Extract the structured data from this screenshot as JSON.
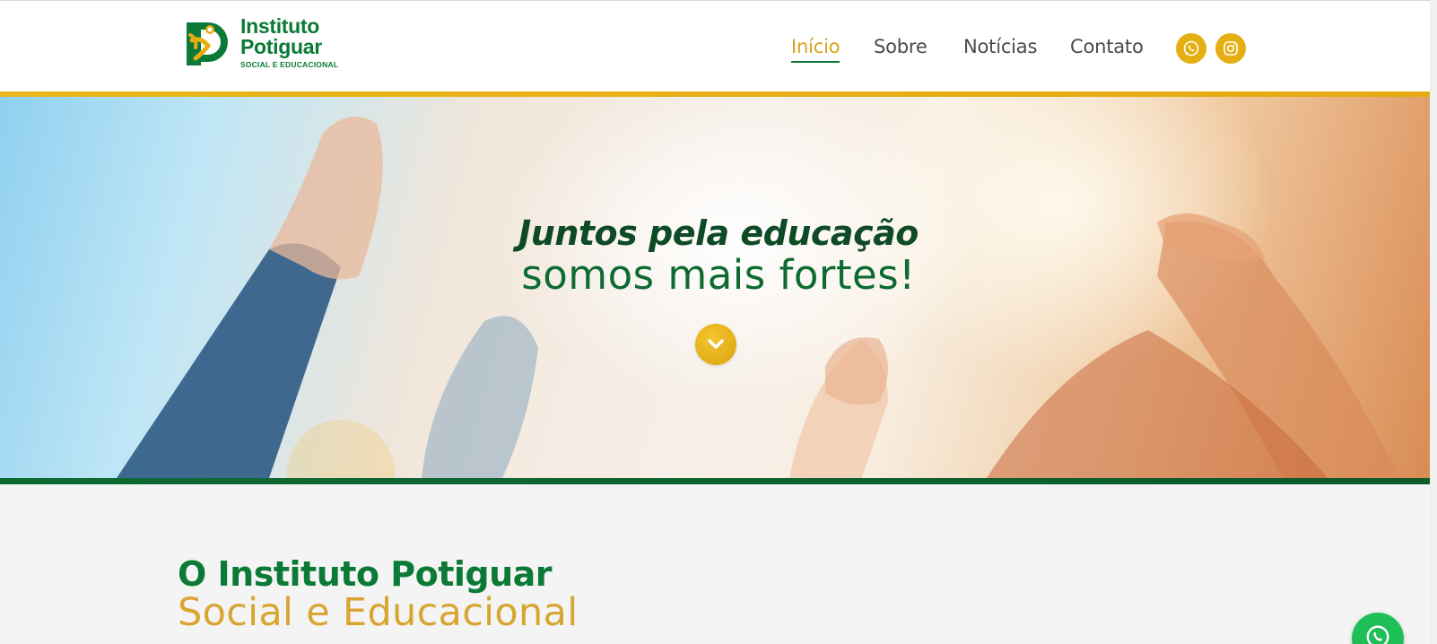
{
  "brand": {
    "line1": "Instituto",
    "line2": "Potiguar",
    "line3": "SOCIAL E EDUCACIONAL",
    "colors": {
      "green": "#0b7a36",
      "gold": "#e5ae13"
    }
  },
  "nav": {
    "items": [
      {
        "label": "Início",
        "active": true
      },
      {
        "label": "Sobre",
        "active": false
      },
      {
        "label": "Notícias",
        "active": false
      },
      {
        "label": "Contato",
        "active": false
      }
    ],
    "social": [
      {
        "icon": "whatsapp-icon"
      },
      {
        "icon": "instagram-icon"
      }
    ]
  },
  "hero": {
    "line1": "Juntos pela educação",
    "line2": "somos mais fortes!",
    "scroll_icon": "chevron-down-icon"
  },
  "about": {
    "title": "O Instituto Potiguar",
    "subtitle": "Social e Educacional"
  },
  "floating": {
    "icon": "whatsapp-icon"
  }
}
